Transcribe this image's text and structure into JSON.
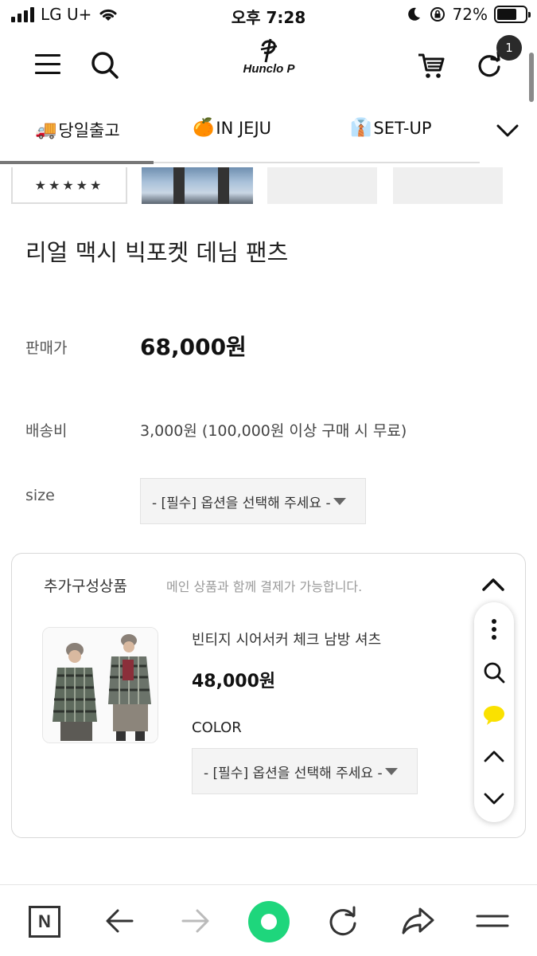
{
  "status_bar": {
    "carrier": "LG U+",
    "time": "오후 7:28",
    "battery_percent": "72%",
    "battery_level": 0.72,
    "icons": [
      "signal-icon",
      "wifi-icon",
      "moon-icon",
      "rotation-lock-icon",
      "battery-icon"
    ]
  },
  "header": {
    "logo_text": "Hunclo P",
    "cart_badge": "1",
    "icons": [
      "menu-icon",
      "search-icon",
      "cart-icon",
      "refresh-icon"
    ]
  },
  "category_nav": {
    "items": [
      {
        "emoji": "🚚",
        "label": "당일출고"
      },
      {
        "emoji": "🍊",
        "label": "IN JEJU"
      },
      {
        "emoji": "👔",
        "label": "SET-UP"
      }
    ],
    "expand_icon": "chevron-down-icon"
  },
  "product": {
    "rating_stars": "★★★★★",
    "title": "리얼 맥시 빅포켓 데님 팬츠",
    "price_label": "판매가",
    "price": "68,000원",
    "shipping_label": "배송비",
    "shipping": "3,000원 (100,000원 이상 구매 시 무료)",
    "size_label": "size",
    "size_select": "- [필수] 옵션을 선택해 주세요 -"
  },
  "addon": {
    "title": "추가구성상품",
    "subtitle": "메인 상품과 함께 결제가 가능합니다.",
    "item": {
      "name": "빈티지 시어서커 체크 남방 셔츠",
      "price": "48,000원",
      "color_label": "COLOR",
      "color_select": "- [필수] 옵션을 선택해 주세요 -"
    }
  },
  "floating_panel": {
    "icons": [
      "more-icon",
      "search-icon",
      "kakao-chat-icon",
      "chevron-up-icon",
      "chevron-down-icon"
    ]
  },
  "bottom_bar": {
    "n_label": "N",
    "icons": [
      "naver-icon",
      "back-arrow-icon",
      "forward-arrow-icon",
      "green-home-icon",
      "reload-icon",
      "share-icon",
      "menu-icon"
    ]
  },
  "colors": {
    "accent_green": "#1ed67c",
    "kakao_yellow": "#fae100",
    "text_dark": "#111111",
    "muted": "#999999"
  }
}
